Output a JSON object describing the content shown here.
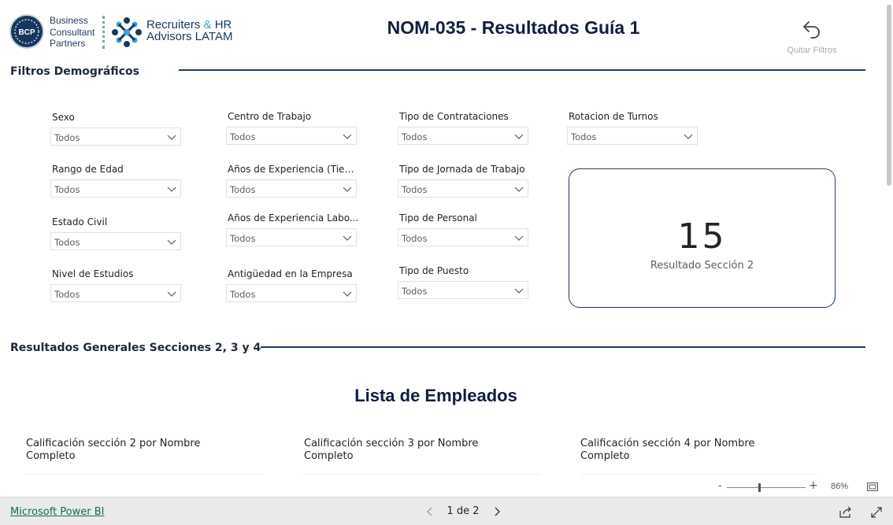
{
  "logos": {
    "bcp_initials": "BCP",
    "bcp_lines": [
      "Business",
      "Consultant",
      "Partners"
    ],
    "recruiters_line1_a": "Recruiters",
    "recruiters_line1_amp": "&",
    "recruiters_line1_b": "HR",
    "recruiters_line2": "Advisors LATAM"
  },
  "header": {
    "title": "NOM-035 - Resultados Guía 1",
    "clear_filters_label": "Quitar Filtros",
    "clear_filters_icon": "undo-arrow-icon"
  },
  "sections": {
    "demographics": "Filtros Demográficos",
    "general": "Resultados Generales Secciones 2, 3 y 4"
  },
  "filters": [
    {
      "label": "Sexo",
      "value": "Todos"
    },
    {
      "label": "Rango de Edad",
      "value": "Todos"
    },
    {
      "label": "Estado Civil",
      "value": "Todos"
    },
    {
      "label": "Nivel de Estudios",
      "value": "Todos"
    },
    {
      "label": "Centro de Trabajo",
      "value": "Todos"
    },
    {
      "label": "Años de Experiencia (Tiem...",
      "value": "Todos"
    },
    {
      "label": "Años de Experiencia Labo...",
      "value": "Todos"
    },
    {
      "label": "Antigüedad en la Empresa",
      "value": "Todos"
    },
    {
      "label": "Tipo de Contrataciones",
      "value": "Todos"
    },
    {
      "label": "Tipo de Jornada de Trabajo",
      "value": "Todos"
    },
    {
      "label": "Tipo de Personal",
      "value": "Todos"
    },
    {
      "label": "Tipo de Puesto",
      "value": "Todos"
    },
    {
      "label": "Rotacion de Turnos",
      "value": "Todos"
    }
  ],
  "card": {
    "value": "15",
    "label": "Resultado Sección 2"
  },
  "employees": {
    "title": "Lista de Empleados",
    "charts": [
      {
        "title_line1": "Calificación sección 2 por Nombre",
        "title_line2": "Completo"
      },
      {
        "title_line1": "Calificación sección 3 por Nombre",
        "title_line2": "Completo"
      },
      {
        "title_line1": "Calificación sección 4 por Nombre",
        "title_line2": "Completo"
      }
    ]
  },
  "zoom": {
    "minus": "-",
    "plus": "+",
    "percent": "86%",
    "level": 0.86
  },
  "footer": {
    "brand_link": "Microsoft Power BI",
    "page_indicator": "1 de 2"
  },
  "colors": {
    "navy": "#1f3b5f",
    "title": "#0f1f3d",
    "link_green": "#106e4f",
    "footer_bg": "#eaeaea"
  }
}
